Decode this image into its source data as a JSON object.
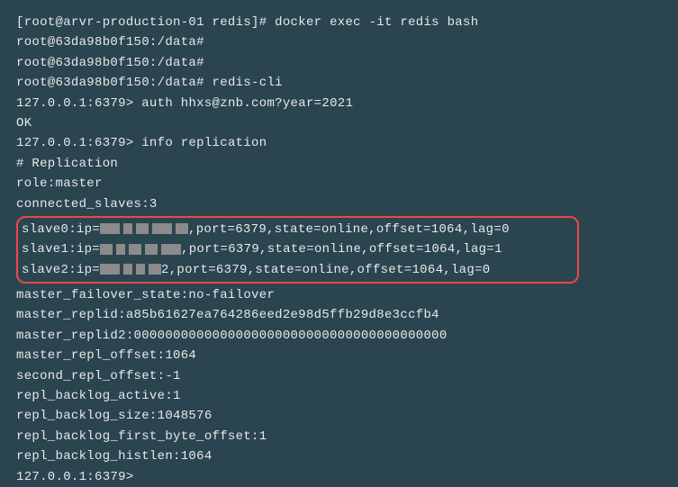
{
  "lines": {
    "l1_prompt": "[root@arvr-production-01 redis]# ",
    "l1_cmd": "docker exec -it redis bash",
    "l2": "root@63da98b0f150:/data#",
    "l3": "root@63da98b0f150:/data#",
    "l4_prompt": "root@63da98b0f150:/data# ",
    "l4_cmd": "redis-cli",
    "l5_prompt": "127.0.0.1:6379> ",
    "l5_cmd": "auth hhxs@znb.com?year=2021",
    "l6": "OK",
    "l7_prompt": "127.0.0.1:6379> ",
    "l7_cmd": "info replication",
    "l8": "# Replication",
    "l9": "role:master",
    "l10": "connected_slaves:3",
    "slave0_pre": "slave0:ip=",
    "slave0_post": ",port=6379,state=online,offset=1064,lag=0",
    "slave1_pre": "slave1:ip=",
    "slave1_post": ",port=6379,state=online,offset=1064,lag=1",
    "slave2_pre": "slave2:ip=",
    "slave2_post": ",port=6379,state=online,offset=1064,lag=0",
    "slave2_mid": "2",
    "l14": "master_failover_state:no-failover",
    "l15": "master_replid:a85b61627ea764286eed2e98d5ffb29d8e3ccfb4",
    "l16": "master_replid2:0000000000000000000000000000000000000000",
    "l17": "master_repl_offset:1064",
    "l18": "second_repl_offset:-1",
    "l19": "repl_backlog_active:1",
    "l20": "repl_backlog_size:1048576",
    "l21": "repl_backlog_first_byte_offset:1",
    "l22": "repl_backlog_histlen:1064",
    "l23": "127.0.0.1:6379>"
  }
}
